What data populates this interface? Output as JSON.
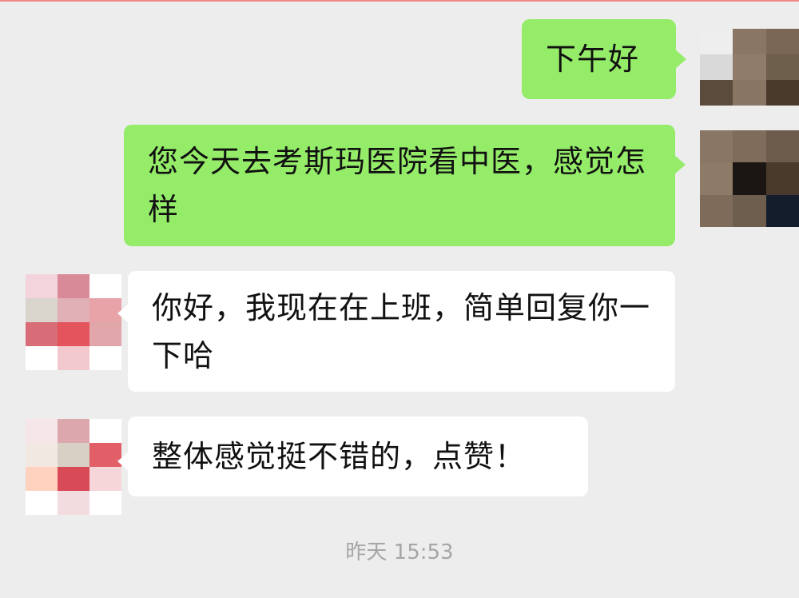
{
  "messages": [
    {
      "side": "sent",
      "text": "下午好",
      "avatar": "self"
    },
    {
      "side": "sent",
      "text": "您今天去考斯玛医院看中医，感觉怎样",
      "avatar": "self"
    },
    {
      "side": "received",
      "text": "你好，我现在在上班，简单回复你一下哈",
      "avatar": "contact"
    },
    {
      "side": "received",
      "text": "整体感觉挺不错的，点赞！",
      "avatar": "contact"
    }
  ],
  "timestamp": "昨天 15:53",
  "avatars": {
    "self": {
      "icon": "pixelated-avatar-icon",
      "colors": [
        "#eeeeee",
        "#8a7664",
        "#7a6855",
        "#d9d9d9",
        "#8f7c69",
        "#6e5e4c",
        "#5a4b3c",
        "#887563",
        "#4a3a2c"
      ]
    },
    "self_second": {
      "icon": "pixelated-avatar-icon",
      "colors": [
        "#8a7664",
        "#7f6c5a",
        "#6d5c4b",
        "#8d7a67",
        "#1b1614",
        "#4a3a2b",
        "#7e6b59",
        "#6e5e4d",
        "#141d2c"
      ]
    },
    "contact": {
      "icon": "pixelated-avatar-icon",
      "colors": [
        "#f3d3dc",
        "#d98a98",
        "#ffffff",
        "#d9d4cc",
        "#e0b0b6",
        "#e8a3a8",
        "#d96d77",
        "#e3545c",
        "#e1a6aa",
        "#ffffff",
        "#f2c9cf",
        "#ffffff"
      ]
    },
    "contact_second": {
      "icon": "pixelated-avatar-icon",
      "colors": [
        "#f5e6e9",
        "#dca8ae",
        "#ffffff",
        "#f2e8e2",
        "#d8cfc5",
        "#e35f68",
        "#ffd2c0",
        "#d84a55",
        "#f6d6d8",
        "#ffffff",
        "#f3dcdf",
        "#ffffff"
      ]
    }
  }
}
